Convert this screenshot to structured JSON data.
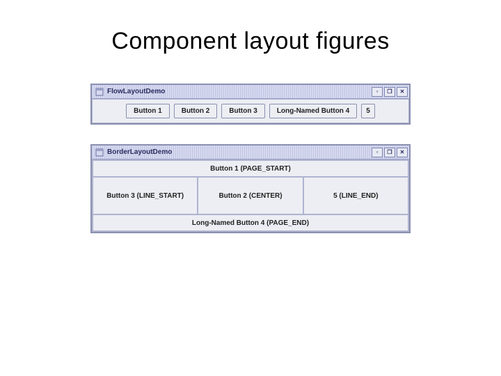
{
  "slide": {
    "title": "Component layout figures"
  },
  "flowDemo": {
    "windowTitle": "FlowLayoutDemo",
    "buttons": {
      "b1": "Button 1",
      "b2": "Button 2",
      "b3": "Button 3",
      "b4": "Long-Named Button 4",
      "b5": "5"
    }
  },
  "borderDemo": {
    "windowTitle": "BorderLayoutDemo",
    "regions": {
      "pageStart": "Button 1 (PAGE_START)",
      "lineStart": "Button 3 (LINE_START)",
      "center": "Button 2 (CENTER)",
      "lineEnd": "5 (LINE_END)",
      "pageEnd": "Long-Named Button 4 (PAGE_END)"
    }
  },
  "windowControls": {
    "minimize": "▫",
    "maximize": "❐",
    "close": "✕"
  }
}
